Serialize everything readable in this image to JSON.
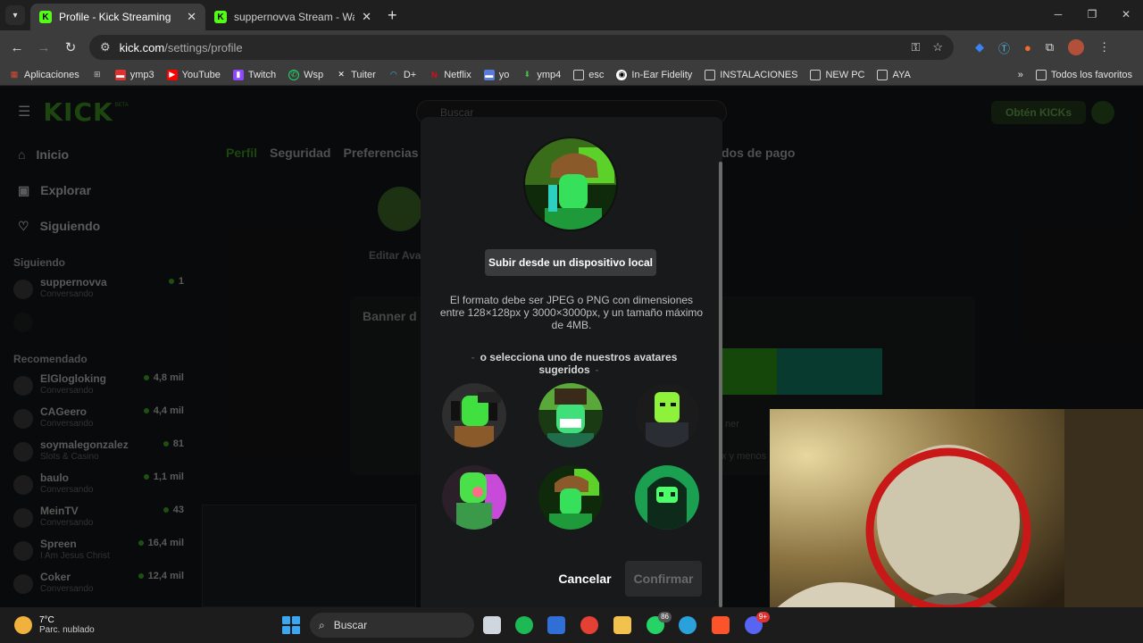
{
  "browser": {
    "tabs": [
      {
        "title": "Profile - Kick Streaming",
        "active": true
      },
      {
        "title": "suppernovva Stream - Watch Li",
        "active": false
      }
    ],
    "url_domain": "kick.com",
    "url_path": "/settings/profile",
    "bookmarks": [
      {
        "label": "Aplicaciones",
        "icon": "apps-grid-icon",
        "color": "#d94a3a"
      },
      {
        "label": "",
        "icon": "grid-icon",
        "color": "#bbbbbb"
      },
      {
        "label": "ymp3",
        "icon": "ymp3-icon",
        "color": "#e03131"
      },
      {
        "label": "YouTube",
        "icon": "youtube-icon",
        "color": "#ff0000"
      },
      {
        "label": "Twitch",
        "icon": "twitch-icon",
        "color": "#9146ff"
      },
      {
        "label": "Wsp",
        "icon": "whatsapp-icon",
        "color": "#25d366"
      },
      {
        "label": "Tuiter",
        "icon": "x-icon",
        "color": "#ffffff"
      },
      {
        "label": "D+",
        "icon": "disney-plus-icon",
        "color": "#3ab6d6"
      },
      {
        "label": "Netflix",
        "icon": "netflix-icon",
        "color": "#e50914"
      },
      {
        "label": "yo",
        "icon": "yo-icon",
        "color": "#5a7ad8"
      },
      {
        "label": "ymp4",
        "icon": "download-icon",
        "color": "#46c241"
      },
      {
        "label": "esc",
        "icon": "folder-icon",
        "color": "#cfcfcf"
      },
      {
        "label": "In-Ear Fidelity",
        "icon": "globe-icon",
        "color": "#ffffff"
      },
      {
        "label": "INSTALACIONES",
        "icon": "folder-icon",
        "color": "#cfcfcf"
      },
      {
        "label": "NEW PC",
        "icon": "folder-icon",
        "color": "#cfcfcf"
      },
      {
        "label": "AYA",
        "icon": "folder-icon",
        "color": "#cfcfcf"
      }
    ],
    "bookmarks_more": "»",
    "all_bookmarks": "Todos los favoritos"
  },
  "kick": {
    "logo": "KICK",
    "logo_beta": "BETA",
    "search_placeholder": "Buscar",
    "get_kicks": "Obtén KICKs",
    "nav": [
      {
        "label": "Inicio",
        "icon": "home-icon"
      },
      {
        "label": "Explorar",
        "icon": "compass-icon"
      },
      {
        "label": "Siguiendo",
        "icon": "heart-icon"
      }
    ],
    "following_title": "Siguiendo",
    "following": [
      {
        "name": "suppernovva",
        "sub": "Conversando",
        "viewers": "1"
      }
    ],
    "recommended_title": "Recomendado",
    "recommended": [
      {
        "name": "ElGlogloking",
        "sub": "Conversando",
        "viewers": "4,8 mil"
      },
      {
        "name": "CAGeero",
        "sub": "Conversando",
        "viewers": "4,4 mil"
      },
      {
        "name": "soymalegonzalez",
        "sub": "Slots & Casino",
        "viewers": "81"
      },
      {
        "name": "baulo",
        "sub": "Conversando",
        "viewers": "1,1 mil"
      },
      {
        "name": "MeinTV",
        "sub": "Conversando",
        "viewers": "43"
      },
      {
        "name": "Spreen",
        "sub": "I Am Jesus Christ",
        "viewers": "16,4 mil"
      },
      {
        "name": "Coker",
        "sub": "Conversando",
        "viewers": "12,4 mil"
      }
    ],
    "settings_tabs": [
      "Perfil",
      "Seguridad",
      "Preferencias"
    ],
    "settings_tab_partial": "dos de pago",
    "edit_avatar_partial": "Editar Ava",
    "banner_partial": "Banner d",
    "partial_text_1": "ner",
    "partial_text_2": "x y menos"
  },
  "modal": {
    "upload_label": "Subir desde un dispositivo local",
    "format_text": "El formato debe ser JPEG o PNG con dimensiones entre 128×128px y 3000×3000px, y un tamaño máximo de 4MB.",
    "suggest_label": "o selecciona uno de nuestros avatares sugeridos",
    "cancel_label": "Cancelar",
    "confirm_label": "Confirmar"
  },
  "taskbar": {
    "temp": "7°C",
    "weather": "Parc. nublado",
    "search": "Buscar",
    "whatsapp_badge": "86",
    "discord_badge": "9+"
  }
}
